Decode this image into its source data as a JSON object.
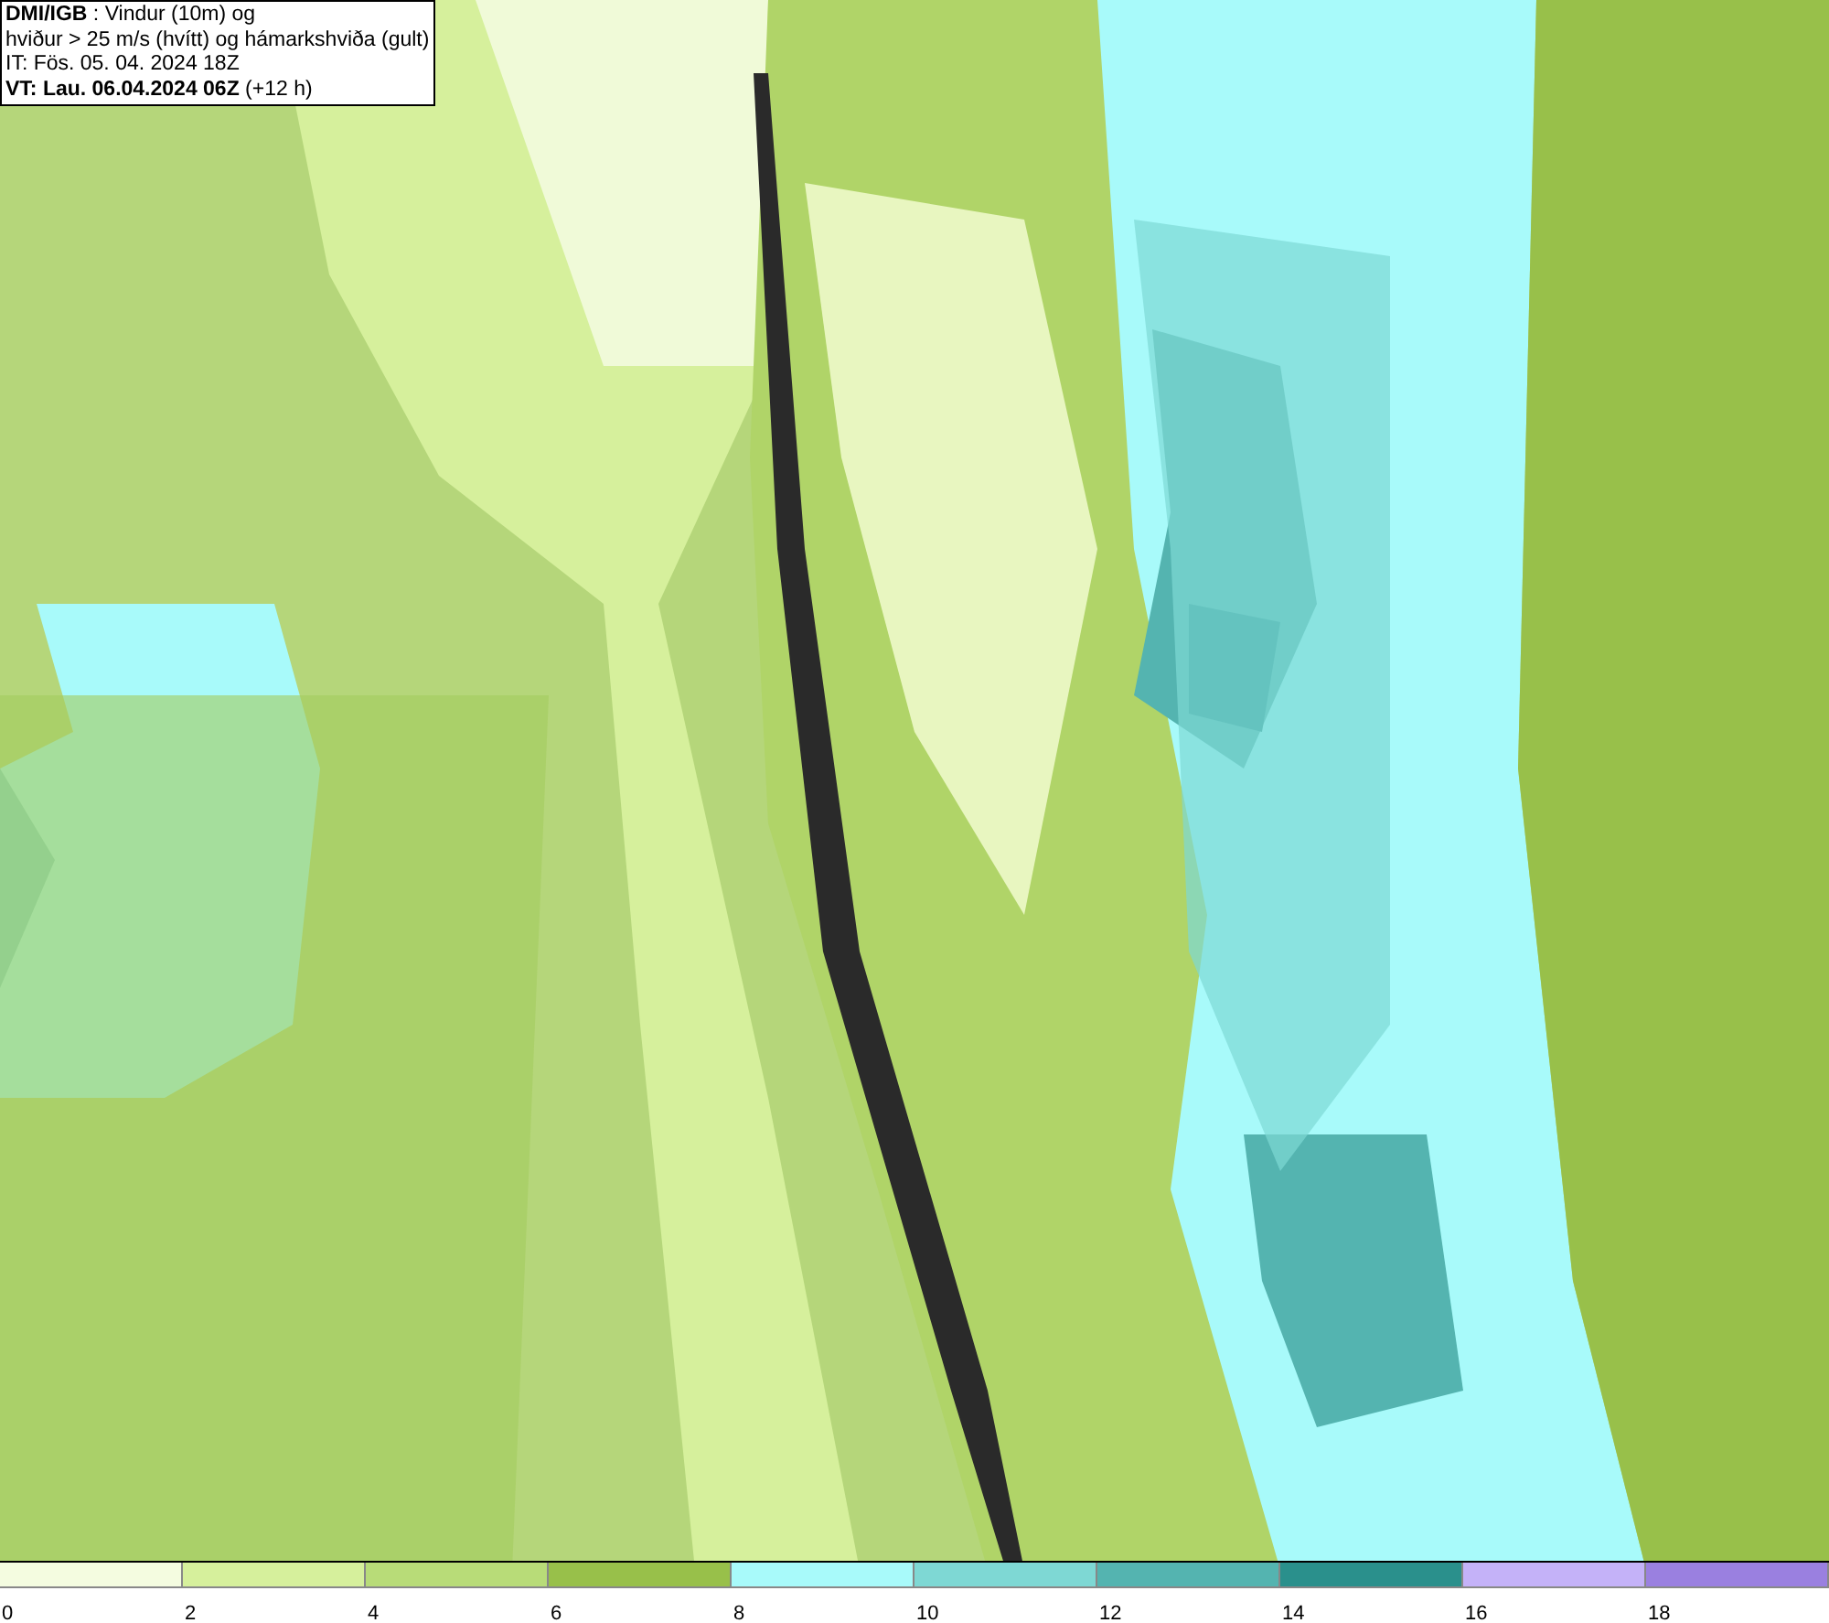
{
  "header": {
    "lines": [
      "**DMI/IGB** : Vindur (10m) og",
      "hviður > 25 m/s (hvítt) og hámarkshviða (gult)",
      "IT: Fös. 05. 04. 2024 18Z",
      "**VT: Lau. 06.04.2024 06Z** (+12 h)"
    ]
  },
  "legend": [
    {
      "label": "0",
      "color": "#f4fce0"
    },
    {
      "label": "2",
      "color": "#d6f09c"
    },
    {
      "label": "4",
      "color": "#b8dc78"
    },
    {
      "label": "6",
      "color": "#98c04a"
    },
    {
      "label": "8",
      "color": "#a8fafa"
    },
    {
      "label": "10",
      "color": "#7ed8d4"
    },
    {
      "label": "12",
      "color": "#54b4b0"
    },
    {
      "label": "14",
      "color": "#2a908c"
    },
    {
      "label": "16",
      "color": "#c4b2f8"
    },
    {
      "label": "18",
      "color": "#9a80e0"
    }
  ]
}
